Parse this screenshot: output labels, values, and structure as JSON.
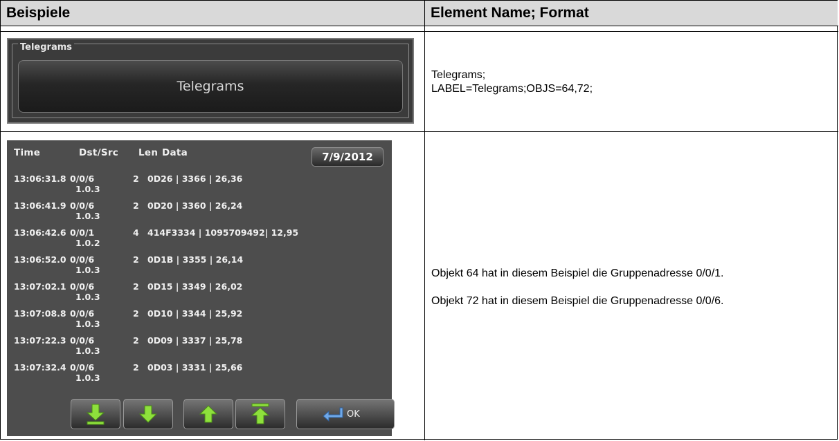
{
  "table": {
    "col1_header": "Beispiele",
    "col2_header": "Element Name; Format"
  },
  "telegrams_widget": {
    "frame_title": "Telegrams",
    "button_label": "Telegrams"
  },
  "telegrams_desc": {
    "line1": "Telegrams;",
    "line2": "LABEL=Telegrams;OBJS=64,72;"
  },
  "monitor": {
    "headers": {
      "time": "Time",
      "dst_src": "Dst/Src",
      "len": "Len",
      "data": "Data"
    },
    "date": "7/9/2012",
    "rows": [
      {
        "time": "13:06:31.8",
        "dst": "0/0/6",
        "src": "1.0.3",
        "len": "2",
        "data": "0D26 | 3366 | 26,36"
      },
      {
        "time": "13:06:41.9",
        "dst": "0/0/6",
        "src": "1.0.3",
        "len": "2",
        "data": "0D20 | 3360 | 26,24"
      },
      {
        "time": "13:06:42.6",
        "dst": "0/0/1",
        "src": "1.0.2",
        "len": "4",
        "data": "414F3334 | 1095709492| 12,95"
      },
      {
        "time": "13:06:52.0",
        "dst": "0/0/6",
        "src": "1.0.3",
        "len": "2",
        "data": "0D1B | 3355 | 26,14"
      },
      {
        "time": "13:07:02.1",
        "dst": "0/0/6",
        "src": "1.0.3",
        "len": "2",
        "data": "0D15 | 3349 | 26,02"
      },
      {
        "time": "13:07:08.8",
        "dst": "0/0/6",
        "src": "1.0.3",
        "len": "2",
        "data": "0D10 | 3344 | 25,92"
      },
      {
        "time": "13:07:22.3",
        "dst": "0/0/6",
        "src": "1.0.3",
        "len": "2",
        "data": "0D09 | 3337 | 25,78"
      },
      {
        "time": "13:07:32.4",
        "dst": "0/0/6",
        "src": "1.0.3",
        "len": "2",
        "data": "0D03 | 3331 | 25,66"
      }
    ],
    "ok_label": "OK",
    "icons": [
      "scroll-bottom-icon",
      "scroll-down-icon",
      "scroll-up-icon",
      "scroll-top-icon",
      "enter-icon"
    ],
    "arrow_color": "#8ee03c"
  },
  "monitor_desc": {
    "line1": "Objekt 64 hat in diesem Beispiel die Gruppenadresse 0/0/1.",
    "line2": "Objekt 72 hat in diesem Beispiel die Gruppenadresse 0/0/6."
  }
}
